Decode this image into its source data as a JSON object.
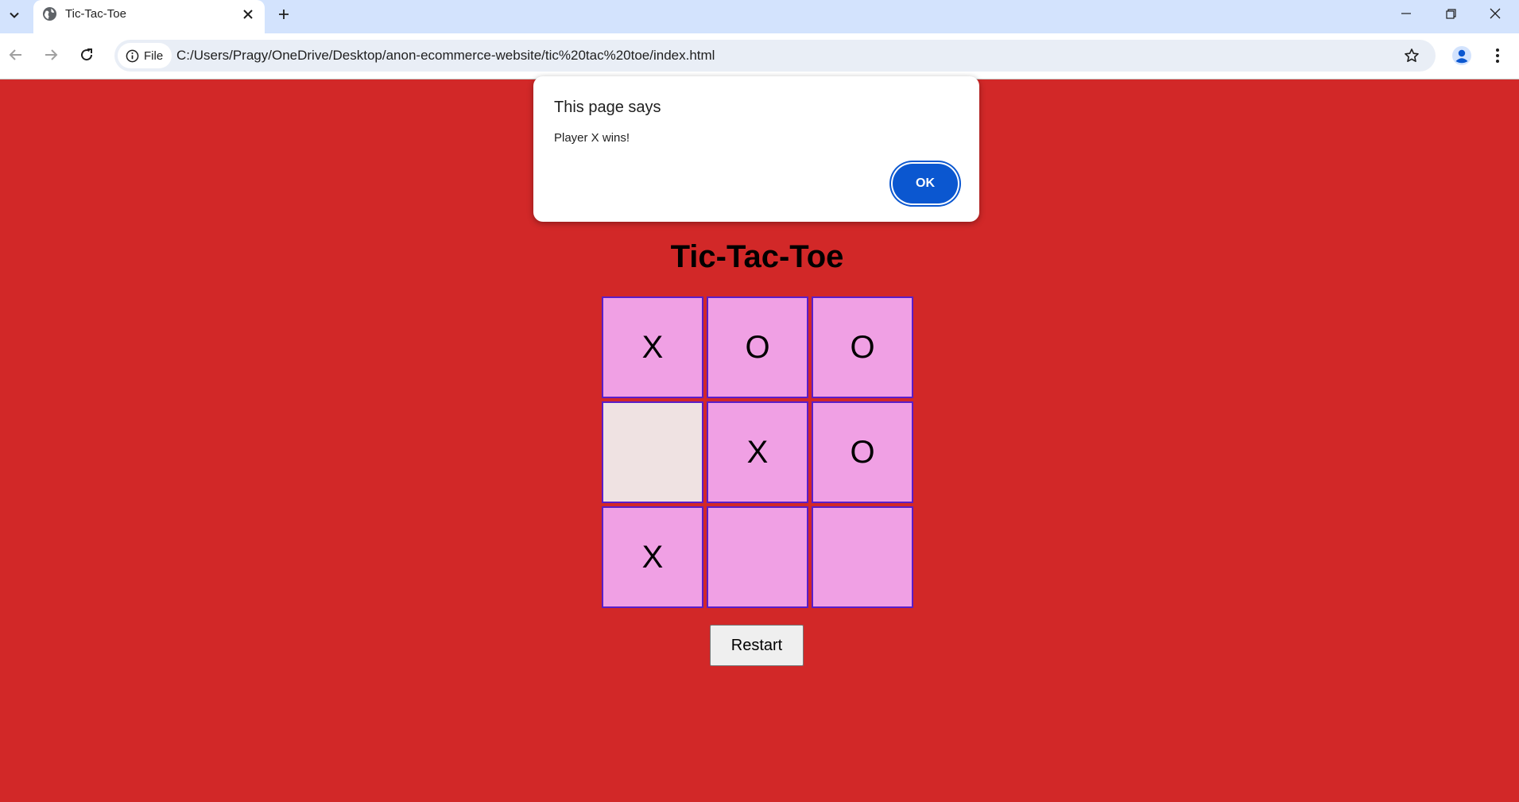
{
  "browser": {
    "tab_title": "Tic-Tac-Toe",
    "address_chip": "File",
    "url": "C:/Users/Pragy/OneDrive/Desktop/anon-ecommerce-website/tic%20tac%20toe/index.html"
  },
  "page": {
    "title": "Tic-Tac-Toe",
    "board": [
      [
        "X",
        "O",
        "O"
      ],
      [
        "",
        "X",
        "O"
      ],
      [
        "X",
        "",
        ""
      ]
    ],
    "restart_label": "Restart"
  },
  "dialog": {
    "title": "This page says",
    "message": "Player X wins!",
    "ok_label": "OK"
  },
  "colors": {
    "page_background": "#d22828",
    "cell_fill": "#f0a0e4",
    "cell_hover_fill": "#efe2e2",
    "cell_border": "#5a1ec8",
    "accent": "#0b57d0"
  }
}
